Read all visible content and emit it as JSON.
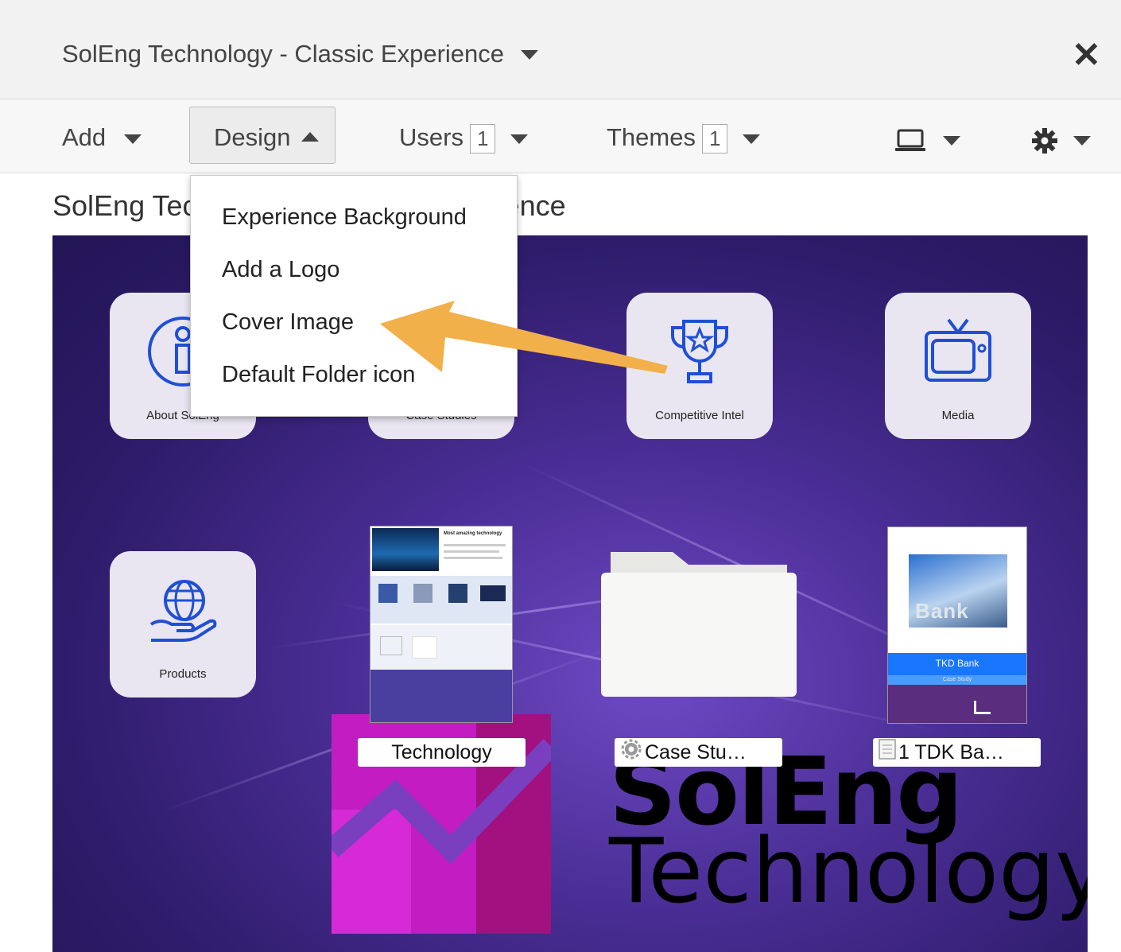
{
  "window": {
    "title": "SolEng Technology - Classic Experience"
  },
  "toolbar": {
    "add_label": "Add",
    "design_label": "Design",
    "users_label": "Users",
    "users_count": "1",
    "themes_label": "Themes",
    "themes_count": "1"
  },
  "page": {
    "heading": "SolEng Technology - Classic Experience"
  },
  "design_menu": {
    "items": [
      "Experience Background",
      "Add a Logo",
      "Cover Image",
      "Default Folder icon"
    ]
  },
  "tiles": [
    {
      "label": "About SolEng",
      "icon": "info-icon"
    },
    {
      "label": "Case Studies",
      "icon": "document-icon"
    },
    {
      "label": "Competitive Intel",
      "icon": "trophy-icon"
    },
    {
      "label": "Media",
      "icon": "tv-icon"
    },
    {
      "label": "Products",
      "icon": "globe-hand-icon"
    }
  ],
  "items": [
    {
      "label": "Technology"
    },
    {
      "label": "Case Stu…",
      "icon": "gear-icon"
    },
    {
      "label": "1 TDK Ba…",
      "icon": "document-icon"
    }
  ],
  "thumb_technology": {
    "title": "Most amazing technology"
  },
  "thumb_bank": {
    "image_text": "Bank",
    "title": "TKD Bank",
    "subtitle": "Case Study"
  },
  "logo": {
    "line1": "SolEng",
    "line2": "Technology"
  },
  "colors": {
    "accent_icon": "#1f4fd6",
    "arrow": "#f2b04a",
    "stage_bg": "#3a2480",
    "brand_magenta": "#c21cc2"
  }
}
